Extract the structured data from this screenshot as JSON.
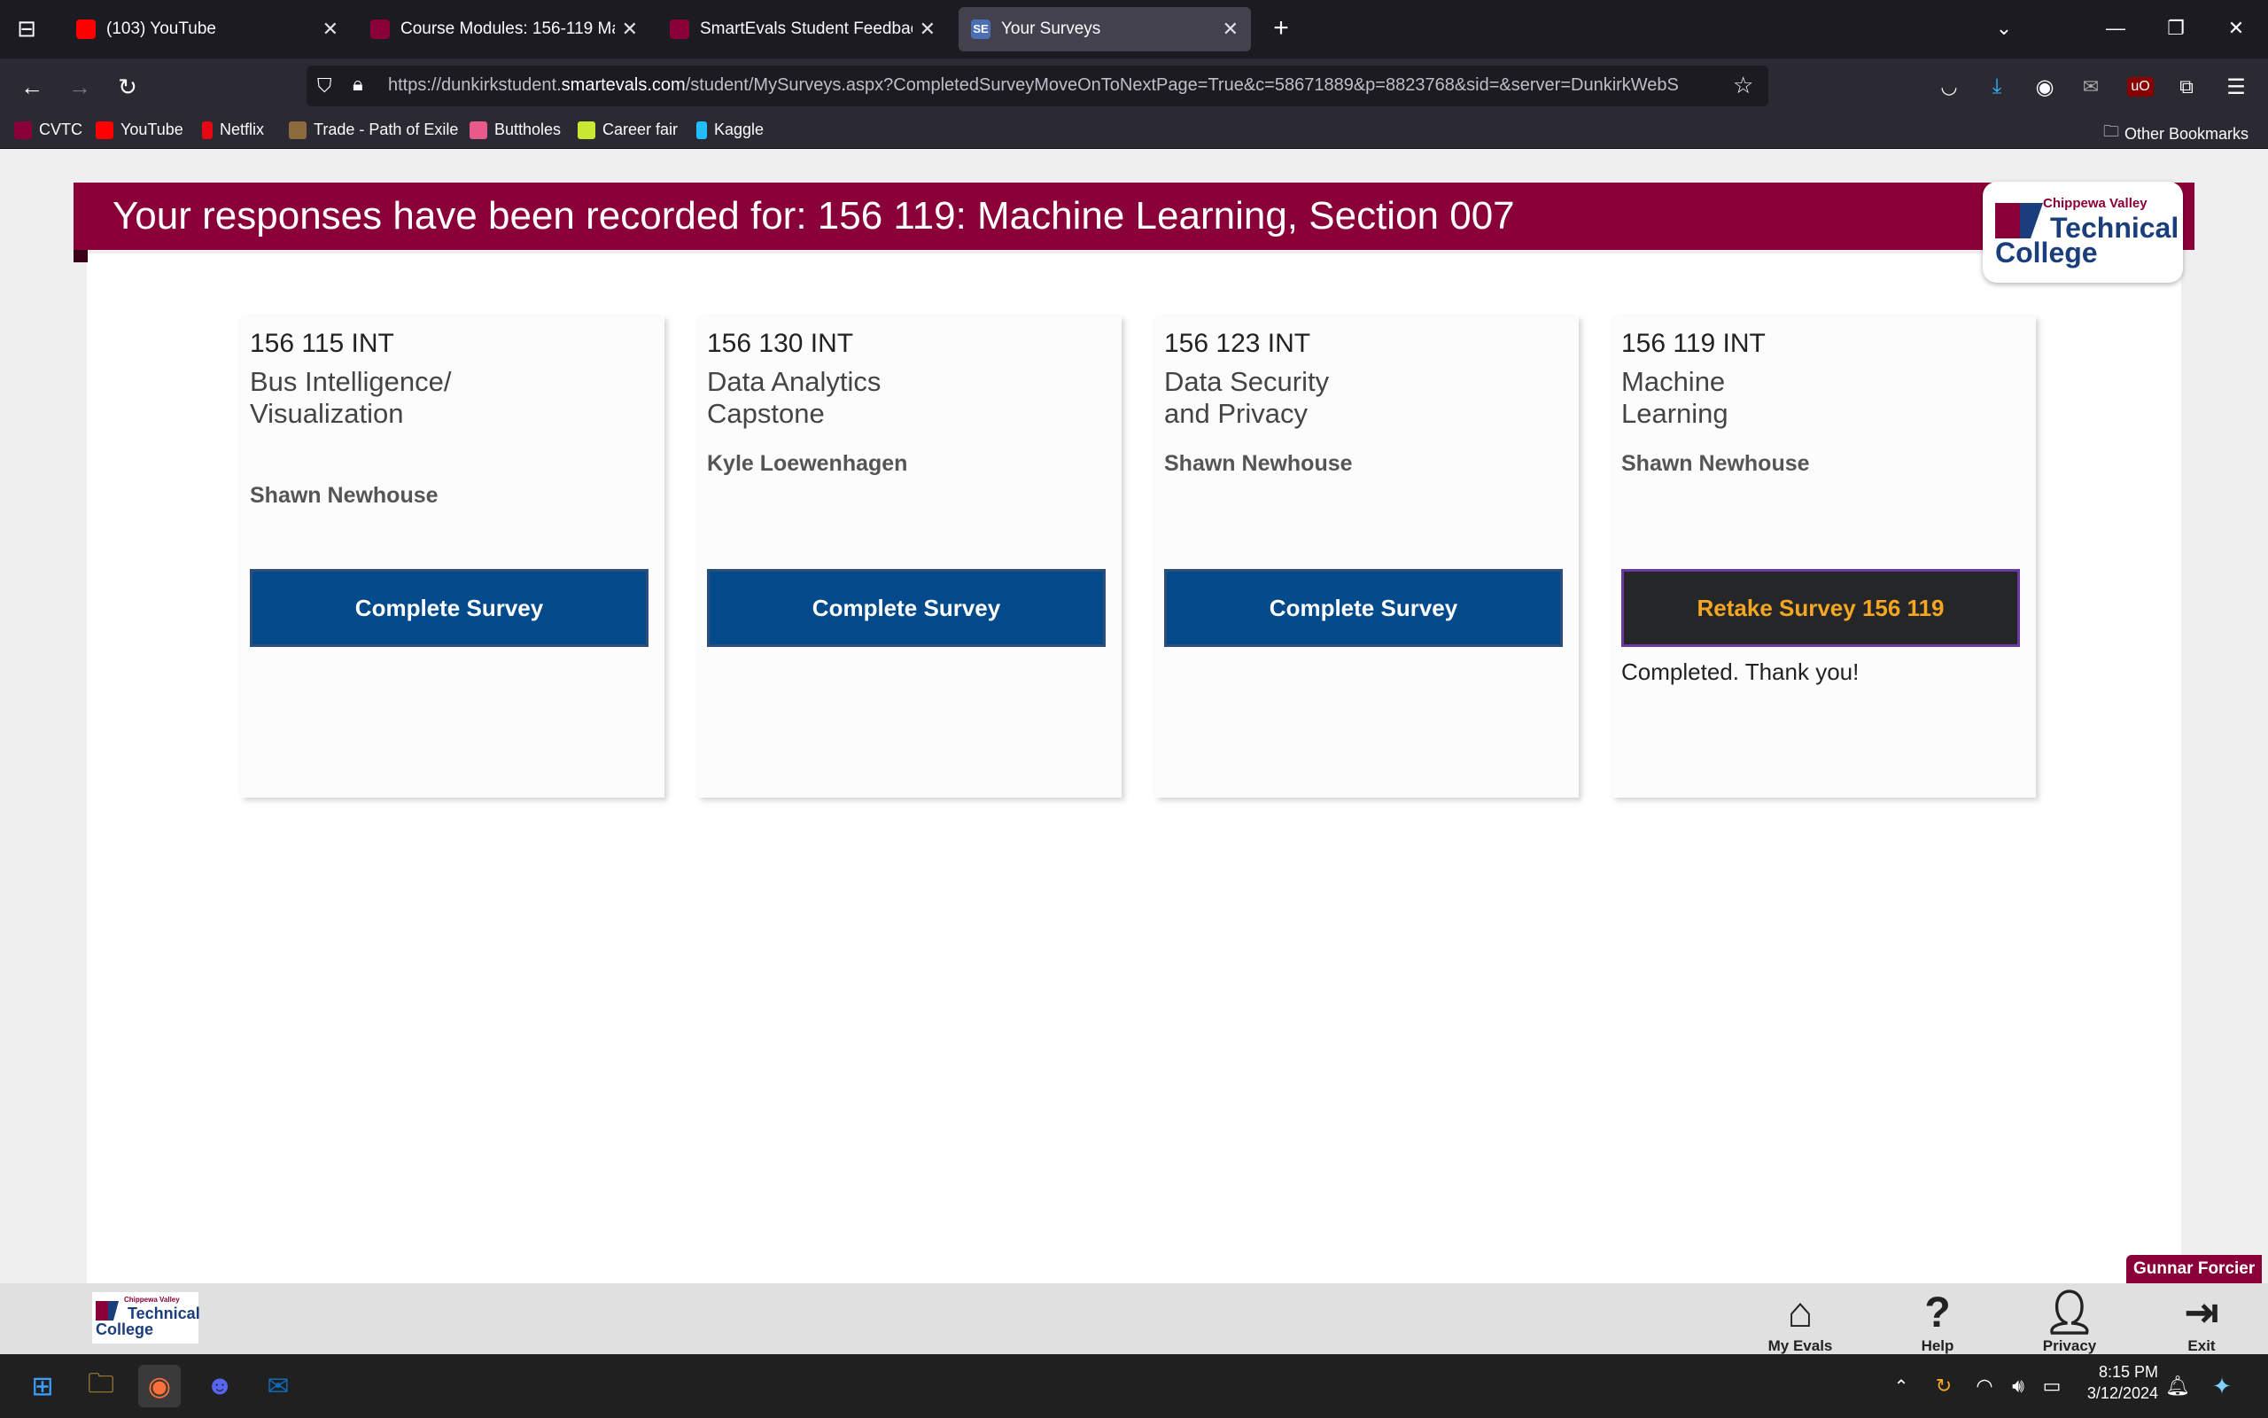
{
  "browser": {
    "tabs": [
      {
        "title": "(103) YouTube",
        "color": "#ff0000"
      },
      {
        "title": "Course Modules: 156-119 Mach",
        "color": "#8a0038"
      },
      {
        "title": "SmartEvals Student Feedback",
        "color": "#8a0038"
      },
      {
        "title": "Your Surveys",
        "color": "#4a6fb5",
        "icon_text": "SE"
      }
    ],
    "url_prefix": "https://dunkirkstudent.",
    "url_domain": "smartevals.com",
    "url_rest": "/student/MySurveys.aspx?CompletedSurveyMoveOnToNextPage=True&c=58671889&p=8823768&sid=&server=DunkirkWebS",
    "bookmarks": [
      {
        "label": "CVTC",
        "color": "#8a0038"
      },
      {
        "label": "YouTube",
        "color": "#ff0000"
      },
      {
        "label": "Netflix",
        "color": "#e50914"
      },
      {
        "label": "Trade - Path of Exile",
        "color": "#8b6a3e"
      },
      {
        "label": "Buttholes",
        "color": "#e85a8a"
      },
      {
        "label": "Career fair",
        "color": "#c9e832"
      },
      {
        "label": "Kaggle",
        "color": "#20beff"
      }
    ],
    "other_bookmarks": "Other Bookmarks"
  },
  "page": {
    "banner": "Your responses have been recorded for: 156 119: Machine Learning, Section 007",
    "logo": {
      "small": "Chippewa Valley",
      "line1": "Technical",
      "line2": "College"
    },
    "brand_color": "#8a0038"
  },
  "surveys": [
    {
      "code": "156 115 INT",
      "name": "Bus Intelligence/ Visualization",
      "instructor": "Shawn Newhouse",
      "button": "Complete Survey",
      "status": ""
    },
    {
      "code": "156 130 INT",
      "name": "Data Analytics Capstone",
      "instructor": "Kyle Loewenhagen",
      "button": "Complete Survey",
      "status": ""
    },
    {
      "code": "156 123 INT",
      "name": "Data Security and Privacy",
      "instructor": "Shawn Newhouse",
      "button": "Complete Survey",
      "status": ""
    },
    {
      "code": "156 119 INT",
      "name": "Machine Learning",
      "instructor": "Shawn Newhouse",
      "button": "Retake Survey 156 119",
      "status": "Completed. Thank you!"
    }
  ],
  "footer": {
    "user": "Gunnar Forcier",
    "buttons": [
      {
        "label": "My Evals",
        "icon": "home-icon"
      },
      {
        "label": "Help",
        "icon": "help-icon"
      },
      {
        "label": "Privacy",
        "icon": "privacy-icon"
      },
      {
        "label": "Exit",
        "icon": "exit-icon"
      }
    ]
  },
  "taskbar": {
    "time": "8:15 PM",
    "date": "3/12/2024"
  }
}
